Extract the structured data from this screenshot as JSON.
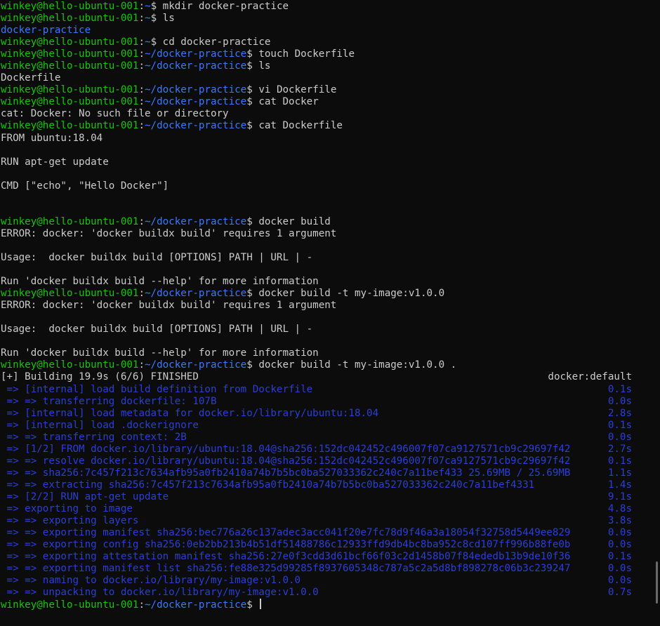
{
  "prompt": {
    "user_host": "winkey@hello-ubuntu-001",
    "sep": ":",
    "home": "~",
    "dir": "~/docker-practice",
    "symbol": "$"
  },
  "lines": [
    {
      "type": "prompt",
      "dir": "~",
      "cmd": " mkdir docker-practice"
    },
    {
      "type": "prompt",
      "dir": "~",
      "cmd": " ls"
    },
    {
      "type": "dir",
      "text": "docker-practice"
    },
    {
      "type": "prompt",
      "dir": "~",
      "cmd": " cd docker-practice"
    },
    {
      "type": "prompt",
      "dir": "~/docker-practice",
      "cmd": " touch Dockerfile"
    },
    {
      "type": "prompt",
      "dir": "~/docker-practice",
      "cmd": " ls"
    },
    {
      "type": "plain",
      "text": "Dockerfile"
    },
    {
      "type": "prompt",
      "dir": "~/docker-practice",
      "cmd": " vi Dockerfile"
    },
    {
      "type": "prompt",
      "dir": "~/docker-practice",
      "cmd": " cat Docker"
    },
    {
      "type": "plain",
      "text": "cat: Docker: No such file or directory"
    },
    {
      "type": "prompt",
      "dir": "~/docker-practice",
      "cmd": " cat Dockerfile"
    },
    {
      "type": "plain",
      "text": "FROM ubuntu:18.04"
    },
    {
      "type": "plain",
      "text": ""
    },
    {
      "type": "plain",
      "text": "RUN apt-get update"
    },
    {
      "type": "plain",
      "text": ""
    },
    {
      "type": "plain",
      "text": "CMD [\"echo\", \"Hello Docker\"]"
    },
    {
      "type": "plain",
      "text": ""
    },
    {
      "type": "plain",
      "text": ""
    },
    {
      "type": "prompt",
      "dir": "~/docker-practice",
      "cmd": " docker build"
    },
    {
      "type": "plain",
      "text": "ERROR: docker: 'docker buildx build' requires 1 argument"
    },
    {
      "type": "plain",
      "text": ""
    },
    {
      "type": "plain",
      "text": "Usage:  docker buildx build [OPTIONS] PATH | URL | -"
    },
    {
      "type": "plain",
      "text": ""
    },
    {
      "type": "plain",
      "text": "Run 'docker buildx build --help' for more information"
    },
    {
      "type": "prompt",
      "dir": "~/docker-practice",
      "cmd": " docker build -t my-image:v1.0.0"
    },
    {
      "type": "plain",
      "text": "ERROR: docker: 'docker buildx build' requires 1 argument"
    },
    {
      "type": "plain",
      "text": ""
    },
    {
      "type": "plain",
      "text": "Usage:  docker buildx build [OPTIONS] PATH | URL | -"
    },
    {
      "type": "plain",
      "text": ""
    },
    {
      "type": "plain",
      "text": "Run 'docker buildx build --help' for more information"
    },
    {
      "type": "prompt",
      "dir": "~/docker-practice",
      "cmd": " docker build -t my-image:v1.0.0 ."
    },
    {
      "type": "buildhead",
      "text": "[+] Building 19.9s (6/6) FINISHED",
      "right": "docker:default"
    },
    {
      "type": "build",
      "text": " => [internal] load build definition from Dockerfile",
      "time": "0.1s"
    },
    {
      "type": "build",
      "text": " => => transferring dockerfile: 107B",
      "time": "0.0s"
    },
    {
      "type": "build",
      "text": " => [internal] load metadata for docker.io/library/ubuntu:18.04",
      "time": "2.8s"
    },
    {
      "type": "build",
      "text": " => [internal] load .dockerignore",
      "time": "0.1s"
    },
    {
      "type": "build",
      "text": " => => transferring context: 2B",
      "time": "0.0s"
    },
    {
      "type": "build",
      "text": " => [1/2] FROM docker.io/library/ubuntu:18.04@sha256:152dc042452c496007f07ca9127571cb9c29697f42",
      "time": "2.7s"
    },
    {
      "type": "build",
      "text": " => => resolve docker.io/library/ubuntu:18.04@sha256:152dc042452c496007f07ca9127571cb9c29697f42",
      "time": "0.1s"
    },
    {
      "type": "build",
      "text": " => => sha256:7c457f213c7634afb95a0fb2410a74b7b5bc0ba527033362c240c7a11bef433 25.69MB / 25.69MB",
      "time": "1.1s"
    },
    {
      "type": "build",
      "text": " => => extracting sha256:7c457f213c7634afb95a0fb2410a74b7b5bc0ba527033362c240c7a11bef4331",
      "time": "1.4s"
    },
    {
      "type": "build",
      "text": " => [2/2] RUN apt-get update",
      "time": "9.1s"
    },
    {
      "type": "build",
      "text": " => exporting to image",
      "time": "4.8s"
    },
    {
      "type": "build",
      "text": " => => exporting layers",
      "time": "3.8s"
    },
    {
      "type": "build",
      "text": " => => exporting manifest sha256:bec776a26c137adec3acc041f20e7fc78d9f46a3a18054f32758d5449ee829",
      "time": "0.0s"
    },
    {
      "type": "build",
      "text": " => => exporting config sha256:0eb2bb213b4b51df51488786c12933ffd9db4bc8ba952c8cd107ff996b88fe0b",
      "time": "0.0s"
    },
    {
      "type": "build",
      "text": " => => exporting attestation manifest sha256:27e0f3cdd3d61bcf66f03c2d1458b07f84ededb13b9de10f36",
      "time": "0.1s"
    },
    {
      "type": "build",
      "text": " => => exporting manifest list sha256:fe88e325d99285f8937605348c787a5c2a5d8bf898278c06b3c239247",
      "time": "0.0s"
    },
    {
      "type": "build",
      "text": " => => naming to docker.io/library/my-image:v1.0.0",
      "time": "0.0s"
    },
    {
      "type": "build",
      "text": " => => unpacking to docker.io/library/my-image:v1.0.0",
      "time": "0.7s"
    },
    {
      "type": "prompt",
      "dir": "~/docker-practice",
      "cmd": " ",
      "cursor": true
    }
  ]
}
